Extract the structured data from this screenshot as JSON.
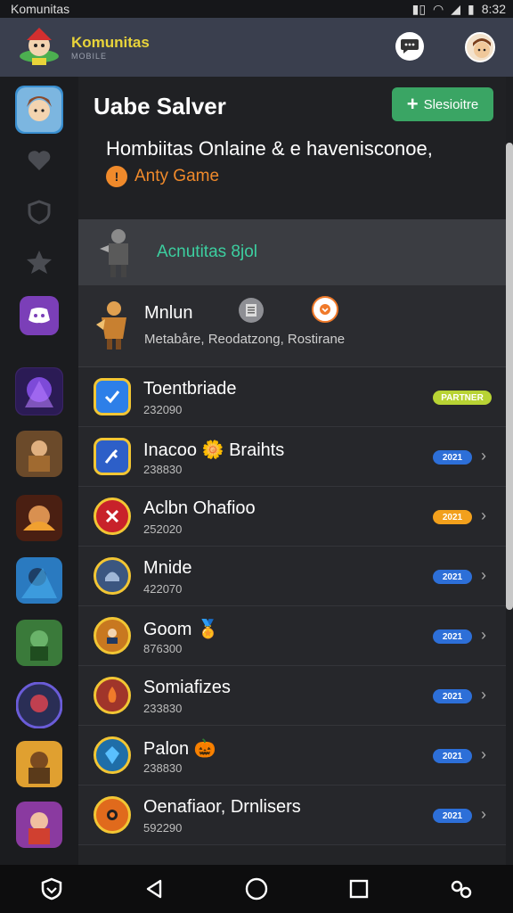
{
  "status_bar": {
    "app": "Komunitas",
    "time": "8:32"
  },
  "app_bar": {
    "brand": "Komunitas",
    "brand_sub": "MOBILE"
  },
  "hero": {
    "title": "Uabe Salver",
    "subscribe_label": "Slesioitre",
    "subtitle": "Hombiitas Onlaine & e havenisconoe,",
    "tag": "Anty Game"
  },
  "section": {
    "label": "Acnutitas 8jol"
  },
  "featured": {
    "name": "Mnlun",
    "meta": "Metabåre, Reodatzong, Rostirane"
  },
  "rows": [
    {
      "name": "Toentbriade",
      "num": "232090",
      "badge": "PARTNER",
      "badge_color": "#b8d334",
      "icon": "check-icon",
      "bg": "#2d7fe8"
    },
    {
      "name": "Inacoo 🌼 Braihts",
      "num": "238830",
      "badge": "2021",
      "badge_color": "#2d6fd8",
      "icon": "tool-icon",
      "bg": "#2d5fc8"
    },
    {
      "name": "Aclbn Ohafioo",
      "num": "252020",
      "badge": "2021",
      "badge_color": "#f2a01c",
      "icon": "cross-icon",
      "bg": "#c8222a"
    },
    {
      "name": "Mnide",
      "num": "422070",
      "badge": "2021",
      "badge_color": "#2d6fd8",
      "icon": "helmet-icon",
      "bg": "#3b5680"
    },
    {
      "name": "Goom 🏅",
      "num": "876300",
      "badge": "2021",
      "badge_color": "#2d6fd8",
      "icon": "hero-icon",
      "bg": "#c87820"
    },
    {
      "name": "Somiafizes",
      "num": "233830",
      "badge": "2021",
      "badge_color": "#2d6fd8",
      "icon": "fire-icon",
      "bg": "#a0352a"
    },
    {
      "name": "Palon 🎃",
      "num": "238830",
      "badge": "2021",
      "badge_color": "#2d6fd8",
      "icon": "gem-icon",
      "bg": "#1f6ea8"
    },
    {
      "name": "Oenafiaor, Drnlisers",
      "num": "592290",
      "badge": "2021",
      "badge_color": "#2d6fd8",
      "icon": "burst-icon",
      "bg": "#e06a1c"
    }
  ],
  "colors": {
    "accent_green": "#3aa564",
    "brand_yellow": "#e9d43a",
    "section_label": "#3ccfa0"
  }
}
